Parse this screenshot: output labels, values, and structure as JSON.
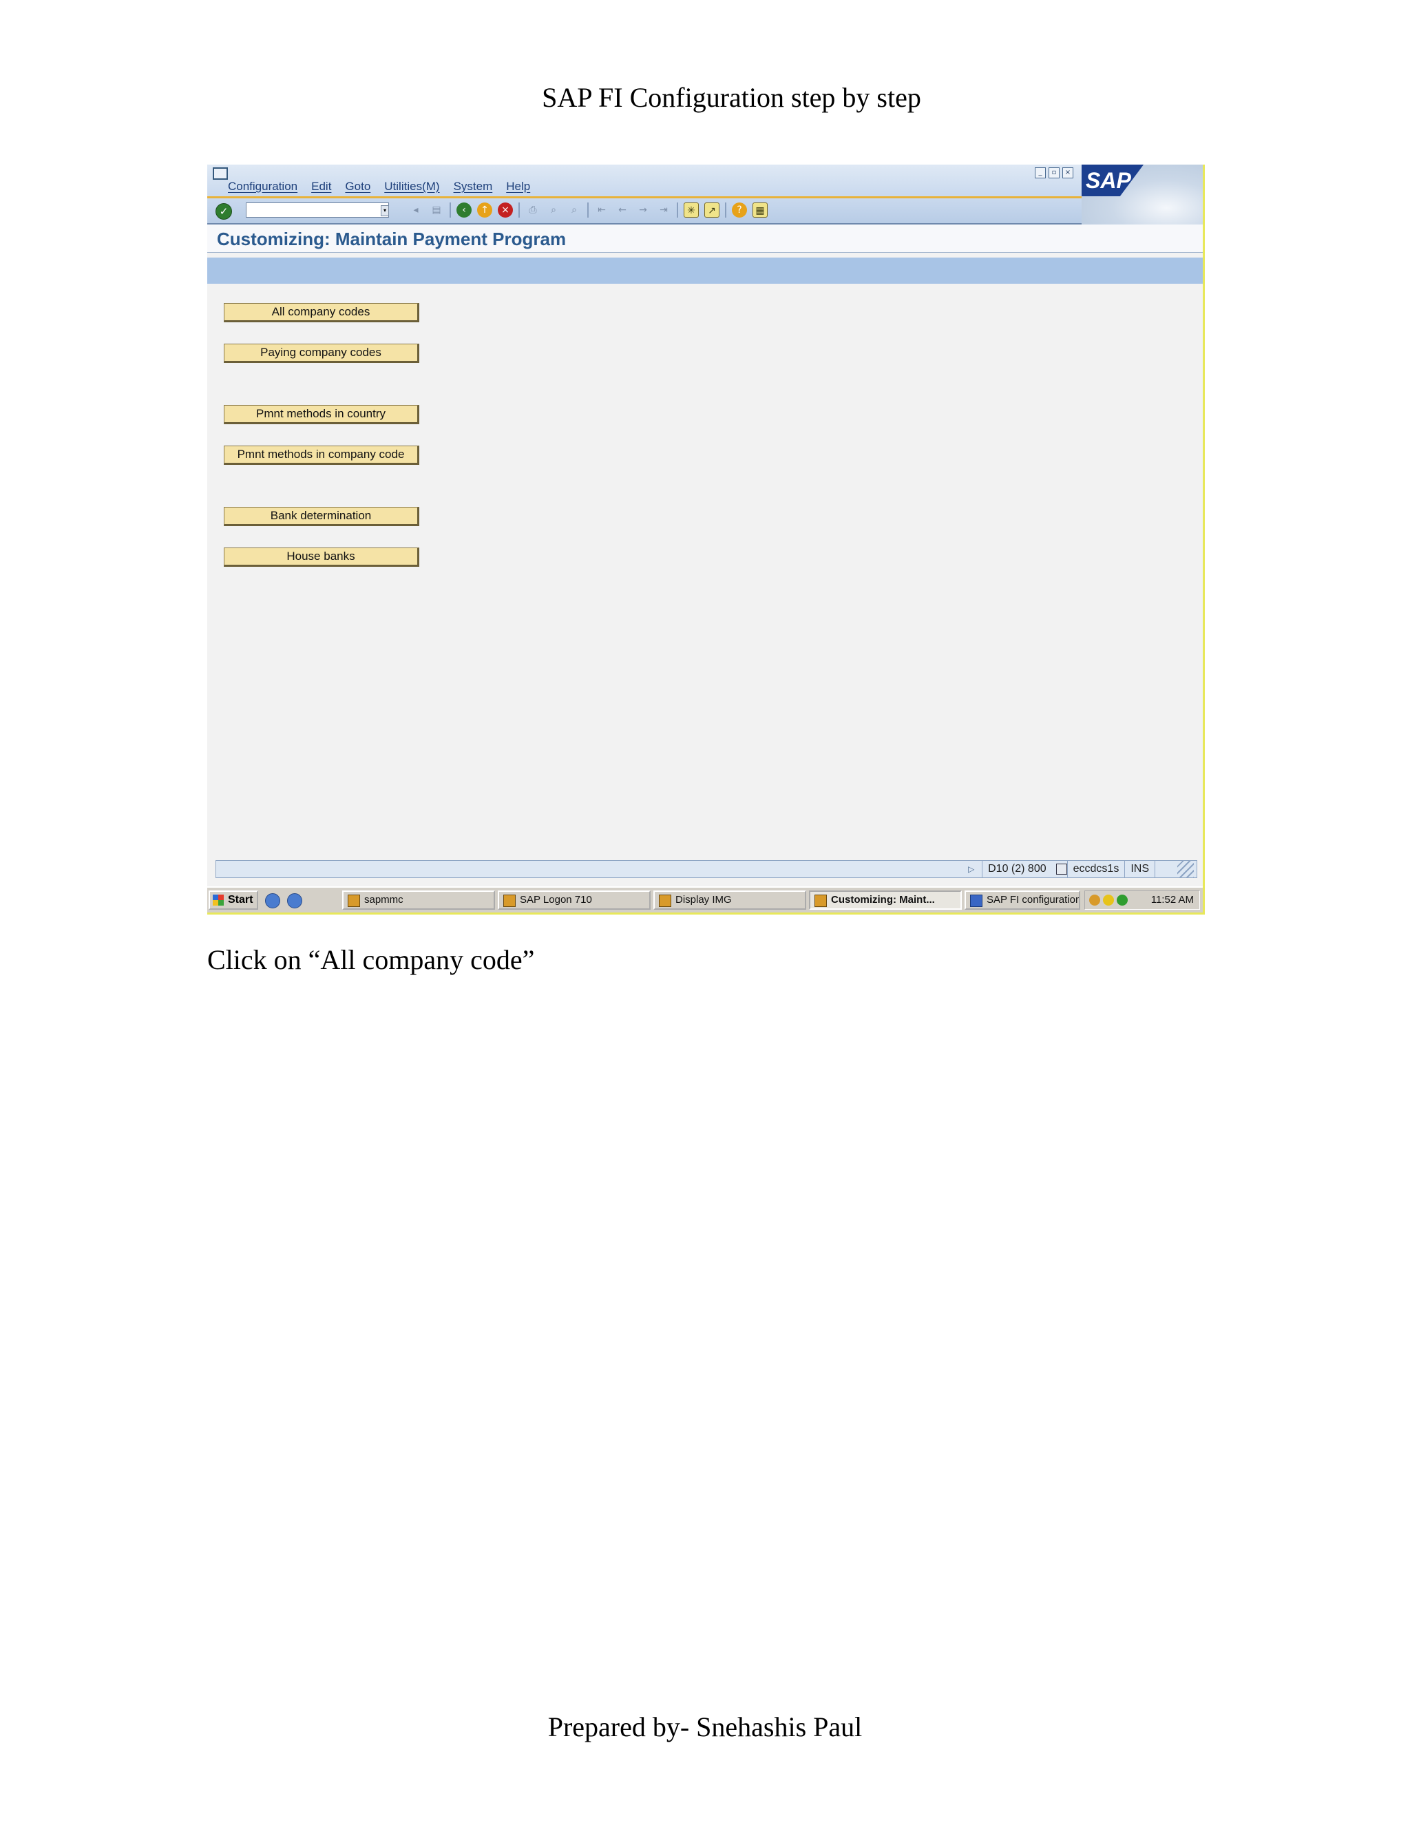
{
  "document": {
    "header": "SAP FI Configuration step by step",
    "caption": "Click on “All company code”",
    "footer": "Prepared by- Snehashis Paul"
  },
  "sap_window": {
    "menu": [
      "Configuration",
      "Edit",
      "Goto",
      "Utilities(M)",
      "System",
      "Help"
    ],
    "logo_text": "SAP",
    "title": "Customizing: Maintain Payment Program",
    "command_field": {
      "value": "",
      "placeholder": ""
    },
    "buttons": [
      "All company codes",
      "Paying company codes",
      "Pmnt methods in country",
      "Pmnt methods in company code",
      "Bank determination",
      "House banks"
    ],
    "status_bar": {
      "system": "D10 (2) 800",
      "server": "eccdcs1s",
      "mode": "INS"
    }
  },
  "taskbar": {
    "start_label": "Start",
    "tasks": [
      "sapmmc",
      "SAP Logon 710",
      "Display IMG",
      "Customizing: Maint...",
      "SAP FI configuration c..."
    ],
    "active_task": "Customizing: Maint...",
    "clock": "11:52 AM"
  },
  "colors": {
    "title_blue": "#2b5a8e",
    "button_fill": "#f5e3a6",
    "app_toolbar": "#a8c4e6",
    "frame_accent": "#e8e85a"
  }
}
